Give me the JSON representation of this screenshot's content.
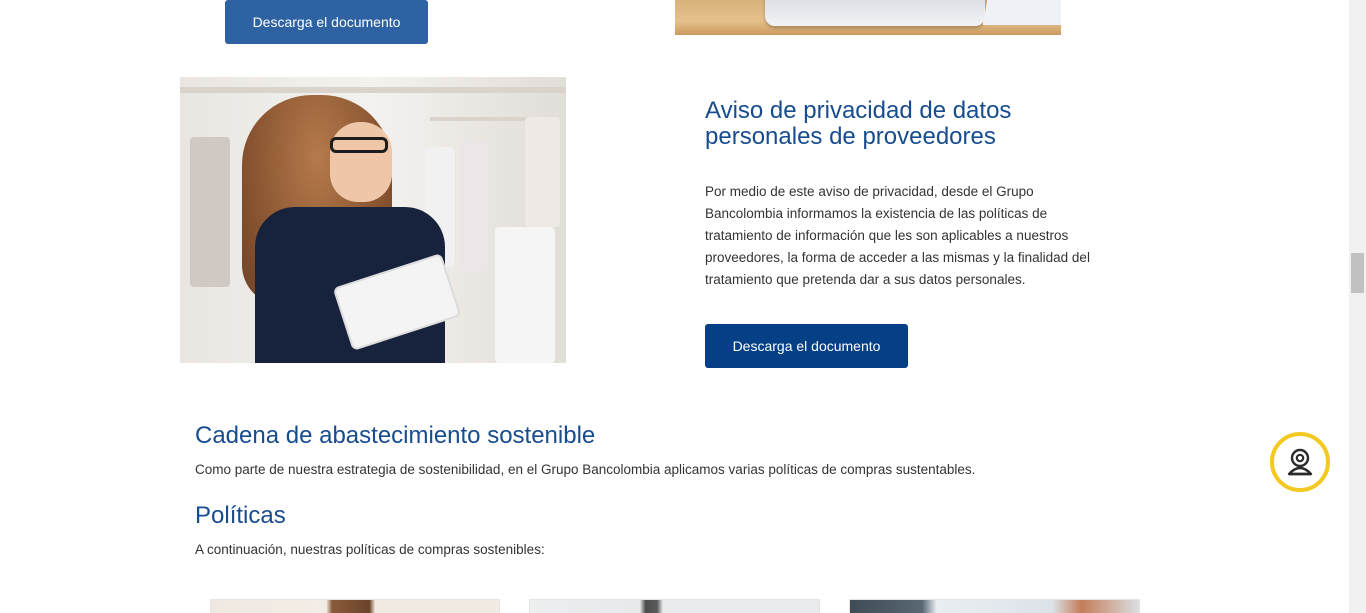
{
  "top_section": {
    "download_label": "Descarga el documento",
    "image_icon": "laptop-photo"
  },
  "privacy_notice": {
    "image_icon": "woman-with-tablet-photo",
    "title": "Aviso de privacidad de datos personales de proveedores",
    "description": "Por medio de este aviso de privacidad, desde el Grupo Bancolombia informamos la existencia de las políticas de tratamiento de información que les son aplicables a nuestros proveedores, la forma de acceder a las mismas y la finalidad del tratamiento que pretenda dar a sus datos personales.",
    "download_label": "Descarga el documento",
    "button_color": "#053f86"
  },
  "supply_chain": {
    "title": "Cadena de abastecimiento sostenible",
    "description": "Como parte de nuestra estrategia de sostenibilidad, en el Grupo Bancolombia aplicamos varias políticas de compras sustentables."
  },
  "policies": {
    "title": "Políticas",
    "description": "A continuación, nuestras políticas de compras sostenibles:",
    "cards": [
      {
        "icon": "policy-photo-1"
      },
      {
        "icon": "policy-photo-2"
      },
      {
        "icon": "policy-photo-3"
      }
    ]
  },
  "chat_widget": {
    "icon": "chat-assistant-icon",
    "accent_color": "#f3c820"
  },
  "colors": {
    "heading": "#174c8e",
    "button_primary": "#053f86",
    "button_secondary": "#2f62a3"
  }
}
